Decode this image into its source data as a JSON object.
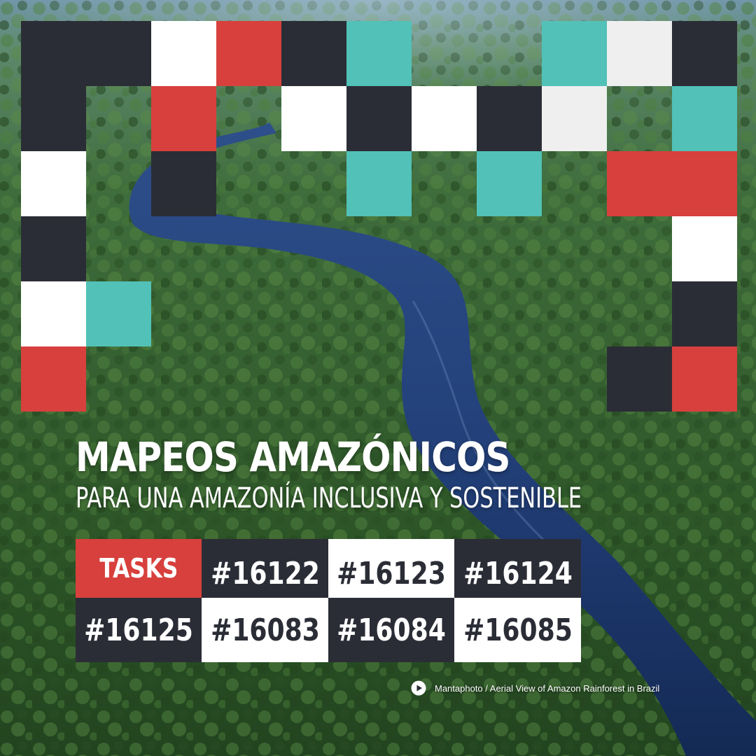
{
  "colors": {
    "dark": "#2b2d36",
    "white": "#ffffff",
    "light_gray": "#efefef",
    "red": "#d7403d",
    "teal": "#52c1b7"
  },
  "background": {
    "description_icon": "rainforest-river-photo-background"
  },
  "title": {
    "headline": "MAPEOS AMAZÓNICOS",
    "subheadline": "PARA UNA AMAZONÍA INCLUSIVA Y SOSTENIBLE"
  },
  "tasks": {
    "header_label": "TASKS",
    "row1": [
      "#16122",
      "#16123",
      "#16124"
    ],
    "row2": [
      "#16125",
      "#16083",
      "#16084",
      "#16085"
    ]
  },
  "credit": {
    "icon": "play-circle-icon",
    "text": "Mantaphoto / Aerial View of Amazon Rainforest in Brazil"
  }
}
